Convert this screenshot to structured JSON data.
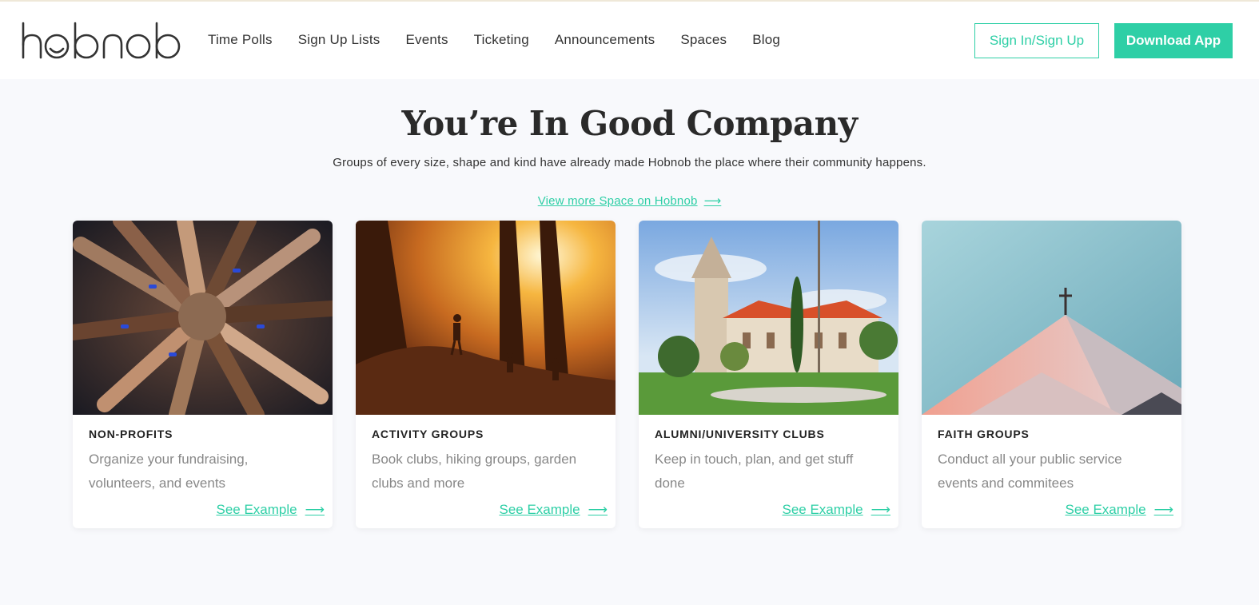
{
  "brand": {
    "logo_text": "hobnob"
  },
  "nav": {
    "items": [
      {
        "label": "Time Polls"
      },
      {
        "label": "Sign Up Lists"
      },
      {
        "label": "Events"
      },
      {
        "label": "Ticketing"
      },
      {
        "label": "Announcements"
      },
      {
        "label": "Spaces"
      },
      {
        "label": "Blog"
      }
    ],
    "signin_label": "Sign In/Sign Up",
    "download_label": "Download App"
  },
  "section": {
    "title": "You’re In Good Company",
    "subtitle": "Groups of every size, shape and kind have already made Hobnob the place where their community happens.",
    "view_more": "View more Space on Hobnob",
    "view_more_arrow": "⟶"
  },
  "cards": [
    {
      "label": "NON-PROFITS",
      "description": "Organize your fundraising, volunteers, and events",
      "link": "See Example",
      "arrow": "⟶",
      "image_icon": "hands-together-photo"
    },
    {
      "label": "ACTIVITY GROUPS",
      "description": "Book clubs, hiking groups, garden clubs and more",
      "link": "See Example",
      "arrow": "⟶",
      "image_icon": "forest-hikers-photo"
    },
    {
      "label": "ALUMNI/UNIVERSITY CLUBS",
      "description": "Keep in touch, plan, and get stuff done",
      "link": "See Example",
      "arrow": "⟶",
      "image_icon": "university-campus-photo"
    },
    {
      "label": "FAITH GROUPS",
      "description": "Conduct all your public service events and commitees",
      "link": "See Example",
      "arrow": "⟶",
      "image_icon": "church-roof-photo"
    }
  ],
  "colors": {
    "accent": "#2ecfa6",
    "background": "#f8f9fc",
    "text": "#2b2b2b",
    "muted": "#888888"
  }
}
